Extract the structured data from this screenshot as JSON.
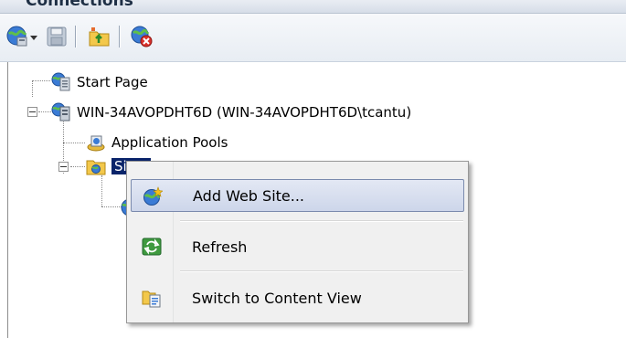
{
  "panel": {
    "title": "Connections"
  },
  "toolbar": {
    "buttons": [
      {
        "icon": "globe-connect-icon"
      },
      {
        "icon": "dropdown-arrow-icon"
      },
      {
        "icon": "save-icon"
      },
      {
        "icon": "folder-up-icon"
      },
      {
        "icon": "disconnect-icon"
      }
    ]
  },
  "tree": {
    "nodes": [
      {
        "label": "Start Page",
        "icon": "start-page-icon"
      },
      {
        "label": "WIN-34AVOPDHT6D (WIN-34AVOPDHT6D\\tcantu)",
        "icon": "server-icon"
      },
      {
        "label": "Application Pools",
        "icon": "application-pools-icon"
      },
      {
        "label": "Sites",
        "icon": "sites-folder-icon",
        "selected": true
      }
    ]
  },
  "context_menu": {
    "items": [
      {
        "label": "Add Web Site...",
        "icon": "add-web-site-icon",
        "hovered": true
      },
      {
        "label": "Refresh",
        "icon": "refresh-icon"
      },
      {
        "label": "Switch to Content View",
        "icon": "content-view-icon"
      }
    ]
  },
  "colors": {
    "selection": "#0a246a",
    "menu_hover_border": "#7a8aad",
    "menu_bg": "#f0f0f0"
  }
}
